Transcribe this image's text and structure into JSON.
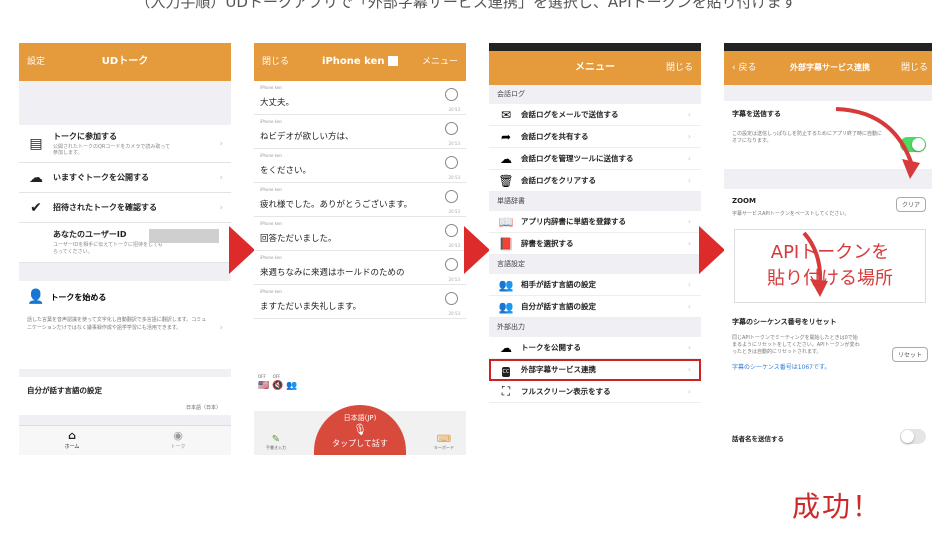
{
  "caption_top": "（入力手順）UDトークアプリで「外部字幕サービス連携」を選択し、APIトークンを貼り付けます",
  "colors": {
    "header": "#e59a3c",
    "arrow": "#dd2a2a",
    "toggle_on": "#4cd964",
    "success": "#cc2a2a"
  },
  "panel1": {
    "header_left": "設定",
    "header_title": "UDトーク",
    "join_title": "トークに参加する",
    "join_desc": "公開されたトークのQRコードをカメラで読み取って参加します。",
    "publish_label": "いますぐトークを公開する",
    "invited_label": "招待されたトークを確認する",
    "user_id_label": "あなたのユーザーID",
    "user_id_desc": "ユーザーIDを相手に伝えてトークに招待をしてもらってください。",
    "start_title": "トークを始める",
    "start_desc": "話した言葉を音声認識を使って文字化し自動翻訳で多言語に翻訳します。コミュニケーションだけではなく議事録作成や語学学習にも活用できます。",
    "lang_title": "自分が話す言語の設定",
    "lang_value": "日本語（日本）",
    "tab_home": "ホーム",
    "tab_talk": "トーク"
  },
  "panel2": {
    "header_left": "閉じる",
    "header_title": "iPhone ken",
    "header_right": "メニュー",
    "messages": [
      {
        "who": "iPhone ken",
        "text": "大丈夫。",
        "time": "20:53"
      },
      {
        "who": "iPhone ken",
        "text": "ねビデオが欲しい方は、",
        "time": "20:53"
      },
      {
        "who": "iPhone ken",
        "text": "をください。",
        "time": "20:53"
      },
      {
        "who": "iPhone ken",
        "text": "疲れ様でした。ありがとうございます。",
        "time": "20:53"
      },
      {
        "who": "iPhone ken",
        "text": "回答ただいました。",
        "time": "20:53"
      },
      {
        "who": "iPhone ken",
        "text": "来週ちなみに来週はホールドのための",
        "time": "20:53"
      },
      {
        "who": "iPhone ken",
        "text": "ますただいま失礼します。",
        "time": "20:53"
      }
    ],
    "toggle_off1": "OFF",
    "toggle_off2": "OFF",
    "mic_lang": "日本語(JP)",
    "mic_label": "タップして話す",
    "left_btn": "手書き入力",
    "right_btn": "キーボード"
  },
  "panel3": {
    "header_title": "メニュー",
    "header_right": "閉じる",
    "sections": [
      {
        "title": "会話ログ",
        "items": [
          {
            "icon": "mail-icon",
            "glyph": "✉",
            "label": "会話ログをメールで送信する"
          },
          {
            "icon": "share-icon",
            "glyph": "➦",
            "label": "会話ログを共有する"
          },
          {
            "icon": "cloud-upload-icon",
            "glyph": "☁",
            "label": "会話ログを管理ツールに送信する"
          },
          {
            "icon": "trash-icon",
            "glyph": "🗑",
            "label": "会話ログをクリアする"
          }
        ]
      },
      {
        "title": "単語辞書",
        "items": [
          {
            "icon": "book-icon",
            "glyph": "📖",
            "label": "アプリ内辞書に単語を登録する"
          },
          {
            "icon": "dictionary-icon",
            "glyph": "📕",
            "label": "辞書を選択する"
          }
        ]
      },
      {
        "title": "言語設定",
        "items": [
          {
            "icon": "people-icon",
            "glyph": "👥",
            "label": "相手が話す言語の設定"
          },
          {
            "icon": "people-icon",
            "glyph": "👥",
            "label": "自分が話す言語の設定"
          }
        ]
      },
      {
        "title": "外部出力",
        "items": [
          {
            "icon": "cloud-icon",
            "glyph": "☁",
            "label": "トークを公開する"
          },
          {
            "icon": "cc-icon",
            "glyph": "CC",
            "label": "外部字幕サービス連携"
          },
          {
            "icon": "fullscreen-icon",
            "glyph": "⛶",
            "label": "フルスクリーン表示をする"
          }
        ]
      }
    ]
  },
  "panel4": {
    "header_left": "戻る",
    "header_title": "外部字幕サービス連携",
    "header_right": "閉じる",
    "send_label": "字幕を送信する",
    "send_desc": "この設定は送信しっぱなしを防止するためにアプリ終了時に自動にオフになります。",
    "zoom_label": "ZOOM",
    "clear_btn": "クリア",
    "zoom_desc": "字幕サービスAPIトークンをペーストしてください。",
    "paste_line1": "APIトークンを",
    "paste_line2": "貼り付ける場所",
    "reset_label": "字幕のシーケンス番号をリセット",
    "reset_desc": "同じAPIトークンでミーティングを開始したときは0で始まるようにリセットをしてください。APIトークンが変わったときは自動的にリセットされます。",
    "reset_btn": "リセット",
    "seq_link": "字幕のシーケンス番号は1067です。",
    "speaker_label": "話者名を送信する"
  },
  "success_text": "成功！"
}
